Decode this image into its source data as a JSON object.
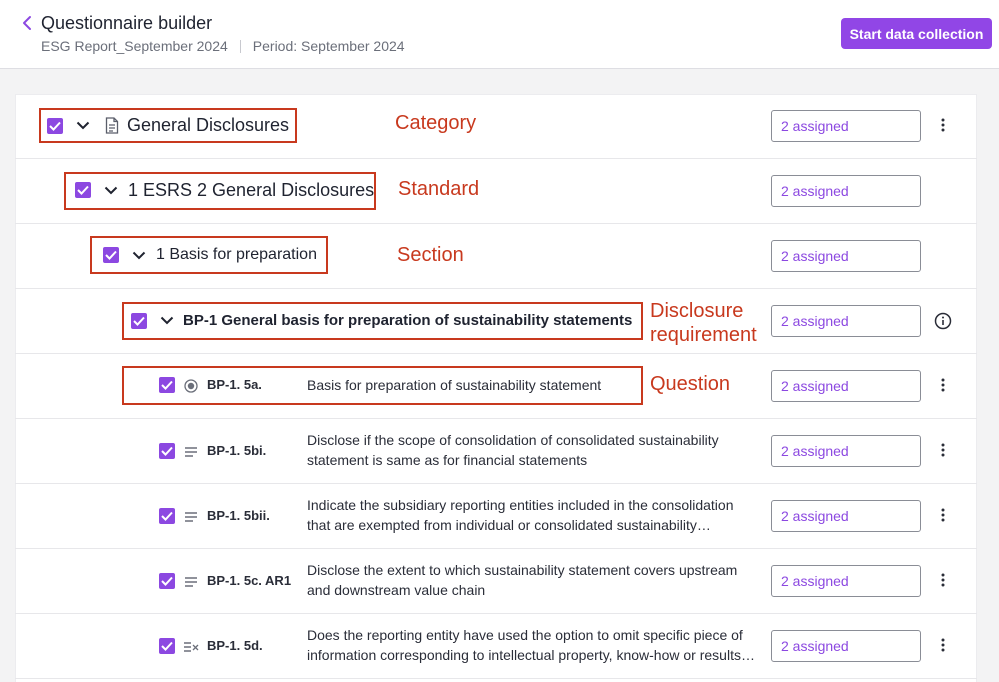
{
  "header": {
    "title": "Questionnaire builder",
    "report_name": "ESG Report_September 2024",
    "period": "Period: September 2024",
    "start_button": "Start data collection"
  },
  "rows": [
    {
      "label": "General Disclosures",
      "assigned": "2 assigned",
      "annotation": "Category"
    },
    {
      "label": "1 ESRS 2 General Disclosures",
      "assigned": "2 assigned",
      "annotation": "Standard"
    },
    {
      "label": "1 Basis for preparation",
      "assigned": "2 assigned",
      "annotation": "Section"
    },
    {
      "label": "BP-1 General basis for preparation of sustainability statements",
      "assigned": "2 assigned",
      "annotation_line1": "Disclosure",
      "annotation_line2": "requirement"
    },
    {
      "code": "BP-1. 5a.",
      "text": "Basis for preparation of sustainability statement",
      "assigned": "2 assigned",
      "annotation": "Question",
      "icon": "radio-icon"
    },
    {
      "code": "BP-1. 5bi.",
      "text_line1": "Disclose if the scope of consolidation of consolidated sustainability",
      "text_line2": "statement is same as for financial statements",
      "assigned": "2 assigned",
      "icon": "text-lines-icon"
    },
    {
      "code": "BP-1. 5bii.",
      "text_line1": "Indicate the subsidiary reporting entities included in the consolidation",
      "text_line2": "that are exempted from individual or consolidated sustainability…",
      "assigned": "2 assigned",
      "icon": "text-lines-icon"
    },
    {
      "code": "BP-1. 5c. AR1",
      "text_line1": "Disclose the extent to which sustainability statement covers upstream",
      "text_line2": "and downstream value chain",
      "assigned": "2 assigned",
      "icon": "text-lines-icon"
    },
    {
      "code": "BP-1. 5d.",
      "text_line1": "Does the reporting entity have used the option to omit specific piece of",
      "text_line2": "information corresponding to intellectual property, know-how or results…",
      "assigned": "2 assigned",
      "icon": "choice-icon"
    }
  ],
  "colors": {
    "accent": "#8c48e1",
    "annotation": "#c8391e"
  }
}
